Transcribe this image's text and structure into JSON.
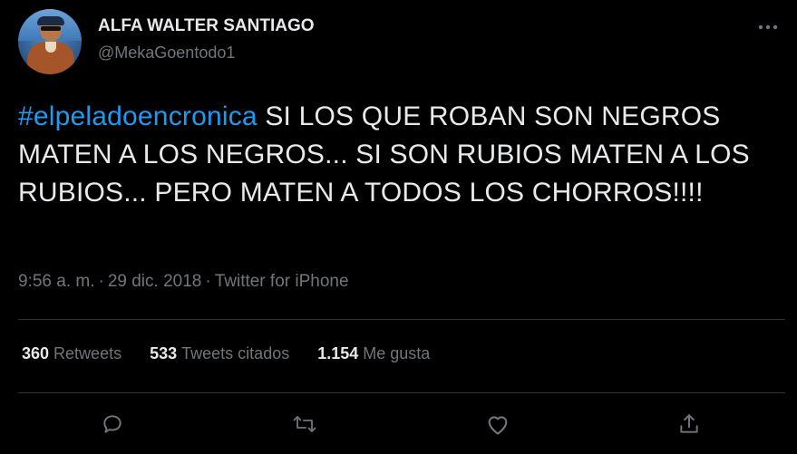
{
  "tweet": {
    "author": {
      "display_name": "ALFA WALTER SANTIAGO",
      "handle": "@MekaGoentodo1"
    },
    "text": {
      "hashtag": "#elpeladoencronica",
      "body": " SI LOS QUE ROBAN SON NEGROS MATEN A LOS NEGROS... SI SON RUBIOS MATEN A LOS RUBIOS... PERO MATEN A TODOS LOS CHORROS!!!!"
    },
    "meta": {
      "time": "9:56 a. m.",
      "separator": "·",
      "date": "29 dic. 2018",
      "source": "Twitter for iPhone"
    },
    "stats": {
      "retweets": {
        "count": "360",
        "label": "Retweets"
      },
      "quotes": {
        "count": "533",
        "label": "Tweets citados"
      },
      "likes": {
        "count": "1.154",
        "label": "Me gusta"
      }
    },
    "actions": [
      "reply-icon",
      "retweet-icon",
      "like-icon",
      "share-icon"
    ]
  },
  "colors": {
    "background": "#000000",
    "text": "#e7e9ea",
    "secondary": "#71767b",
    "link": "#1d9bf0",
    "divider": "#2f3336"
  }
}
